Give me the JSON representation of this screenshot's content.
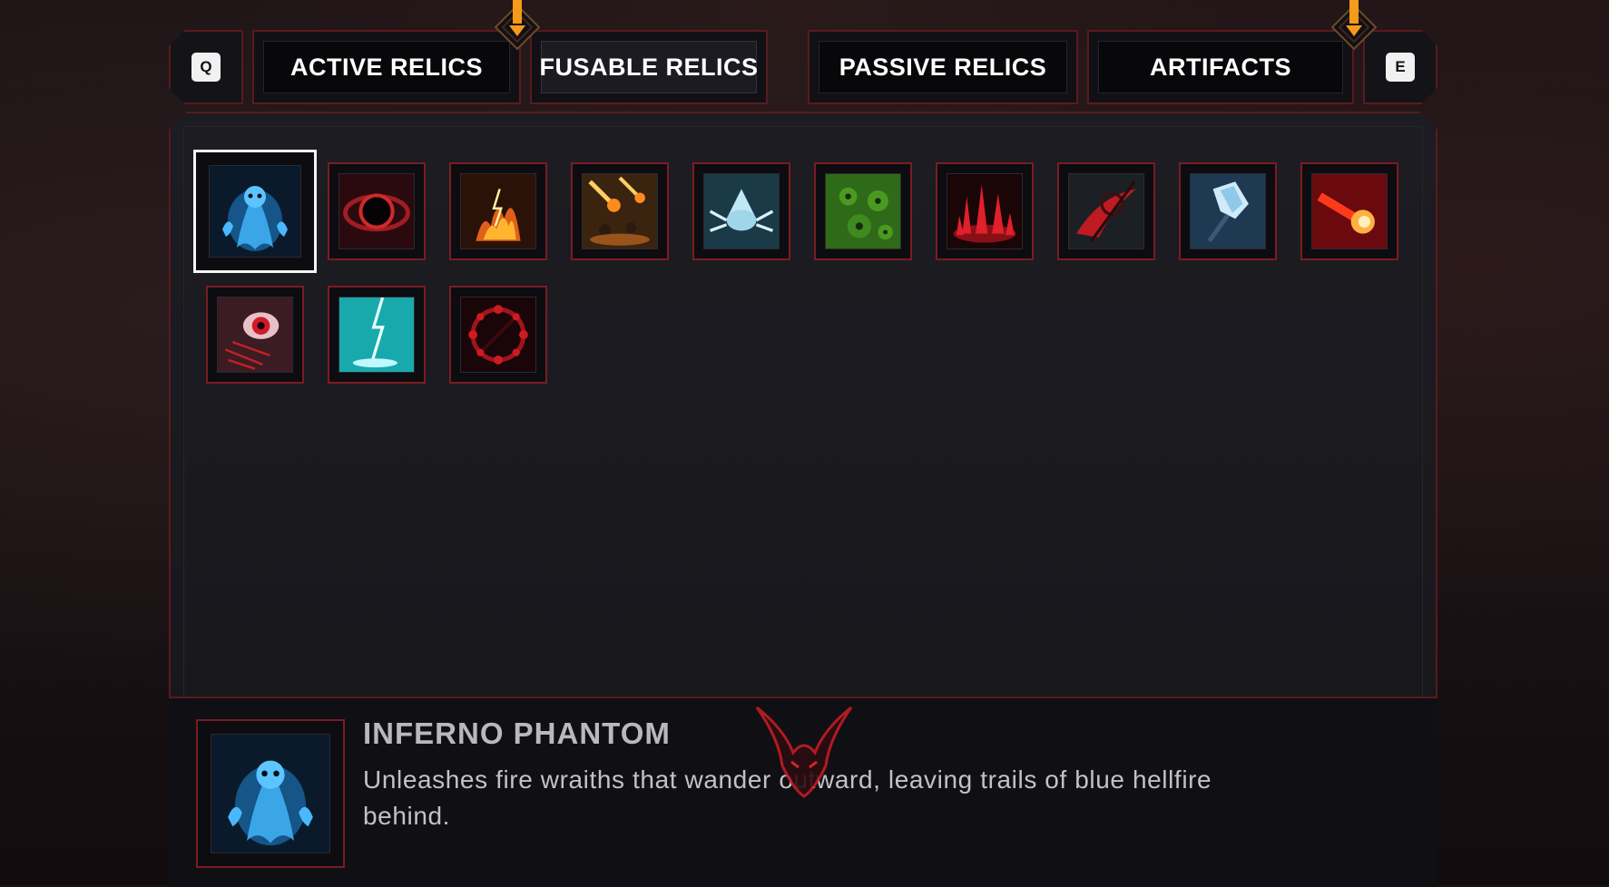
{
  "tabs": {
    "prev_key": "Q",
    "next_key": "E",
    "items": [
      {
        "label": "ACTIVE RELICS",
        "has_notification": true
      },
      {
        "label": "FUSABLE RELICS",
        "selected": true
      },
      {
        "label": "PASSIVE RELICS"
      },
      {
        "label": "ARTIFACTS",
        "has_notification": true
      }
    ]
  },
  "relics": [
    {
      "icon": "blue-flame-ghost-icon",
      "selected": true
    },
    {
      "icon": "black-hole-icon"
    },
    {
      "icon": "fire-lightning-icon"
    },
    {
      "icon": "meteor-shower-icon"
    },
    {
      "icon": "ice-spider-icon"
    },
    {
      "icon": "poison-swarm-icon"
    },
    {
      "icon": "blood-spikes-icon"
    },
    {
      "icon": "blood-scythe-icon"
    },
    {
      "icon": "ice-axe-icon"
    },
    {
      "icon": "fire-bolt-icon"
    },
    {
      "icon": "evil-eye-icon"
    },
    {
      "icon": "cyan-lightning-icon"
    },
    {
      "icon": "blood-ring-icon"
    }
  ],
  "details": {
    "icon": "blue-flame-ghost-icon",
    "title": "INFERNO PHANTOM",
    "description": "Unleashes fire wraiths that wander outward, leaving trails of blue hellfire behind."
  },
  "colors": {
    "frame_red": "#7a1c22",
    "panel_bg": "#1c1c22",
    "notification_orange": "#f59a1a",
    "selected_border": "#f4f4f4"
  }
}
